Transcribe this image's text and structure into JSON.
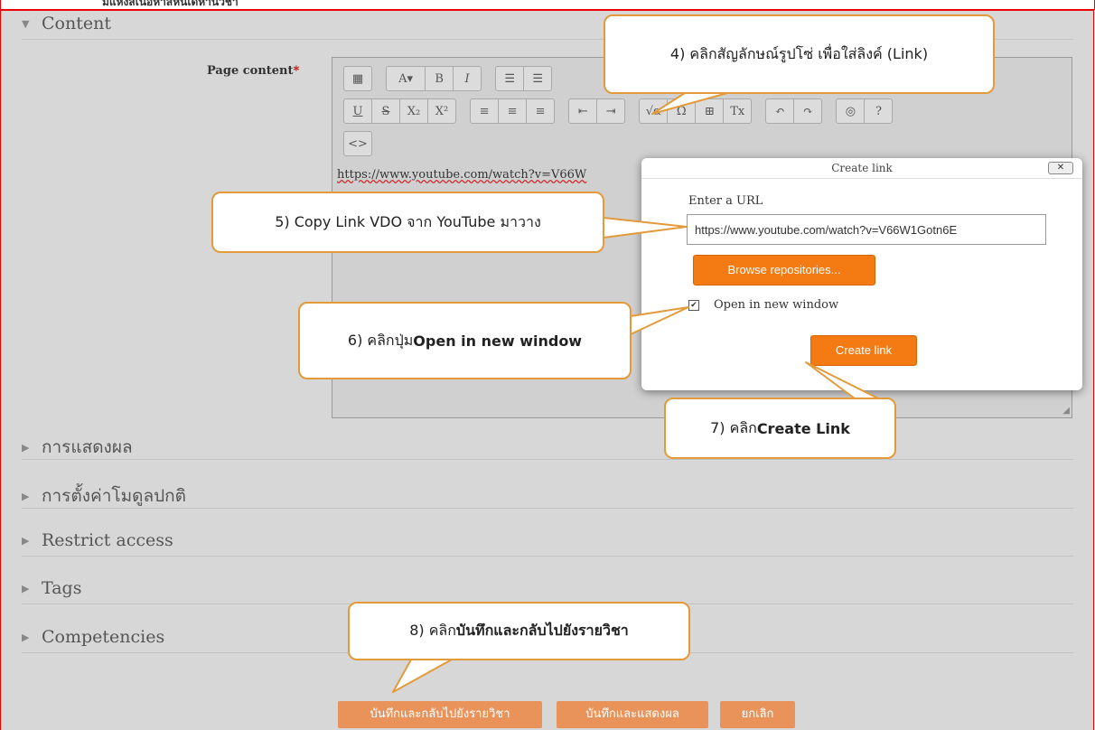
{
  "top_strip_text": "มแหงสเนอหาสหนเดหานวชา",
  "sections": {
    "content": "Content",
    "display": "การแสดงผล",
    "common_settings": "การตั้งค่าโมดูลปกติ",
    "restrict": "Restrict access",
    "tags": "Tags",
    "competencies": "Competencies"
  },
  "page_content": {
    "label": "Page content",
    "required_mark": "*"
  },
  "toolbar_row1": [
    "▦",
    "A▾",
    "B",
    "I",
    "☰",
    "☰"
  ],
  "toolbar_row2": [
    "U",
    "S",
    "X₂",
    "X²",
    "≡",
    "≡",
    "≡",
    "⇤",
    "⇥",
    "√α",
    "Ω",
    "⊞",
    "Tx",
    "↶",
    "↷",
    "◎",
    "?"
  ],
  "toolbar_row3": [
    "<>"
  ],
  "editor_text": "https://www.youtube.com/watch?v=V66W",
  "dialog": {
    "title": "Create link",
    "close": "✕",
    "url_label": "Enter a URL",
    "url_value": "https://www.youtube.com/watch?v=V66W1Gotn6E",
    "browse_label": "Browse repositories...",
    "checkbox_label": "Open in new window",
    "checkbox_checked": true,
    "create_label": "Create link"
  },
  "callouts": {
    "c4": "4)  คลิกสัญลักษณ์รูปโซ่ เพื่อใส่ลิงค์ (Link)",
    "c5": "5) Copy Link VDO จาก YouTube มาวาง",
    "c6_prefix": "6) คลิกปุ่ม ",
    "c6_bold": "Open in new window",
    "c7_prefix": "7) คลิก ",
    "c7_bold": "Create Link",
    "c8_prefix": "8) คลิก ",
    "c8_bold": "บันทึกและกลับไปยังรายวิชา"
  },
  "buttons": {
    "save_return": "บันทึกและกลับไปยังรายวิชา",
    "save_display": "บันทึกและแสดงผล",
    "cancel": "ยกเลิก"
  },
  "colors": {
    "accent": "#f47a13",
    "callout_border": "#e39a3b",
    "frame": "#e00000"
  }
}
